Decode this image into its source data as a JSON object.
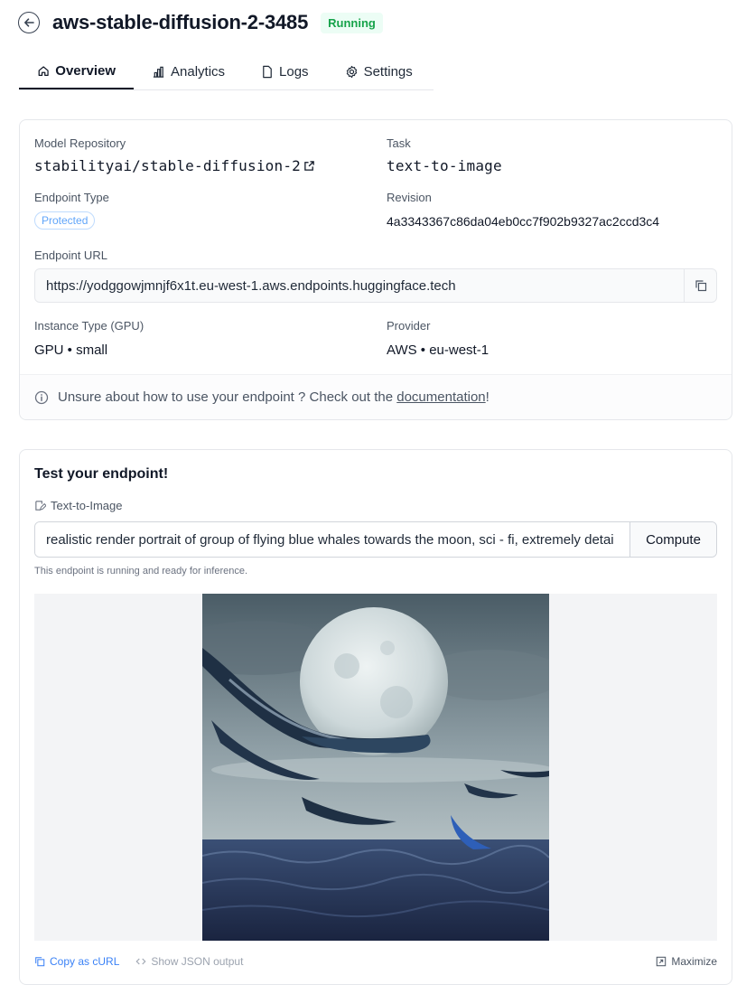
{
  "header": {
    "title": "aws-stable-diffusion-2-3485",
    "status": "Running"
  },
  "tabs": [
    {
      "label": "Overview",
      "icon": "home-icon",
      "active": true
    },
    {
      "label": "Analytics",
      "icon": "bar-chart-icon",
      "active": false
    },
    {
      "label": "Logs",
      "icon": "file-icon",
      "active": false
    },
    {
      "label": "Settings",
      "icon": "gear-icon",
      "active": false
    }
  ],
  "overview": {
    "model_repository_label": "Model Repository",
    "model_repository": "stabilityai/stable-diffusion-2",
    "task_label": "Task",
    "task": "text-to-image",
    "endpoint_type_label": "Endpoint Type",
    "endpoint_type": "Protected",
    "revision_label": "Revision",
    "revision": "4a3343367c86da04eb0cc7f902b9327ac2ccd3c4",
    "endpoint_url_label": "Endpoint URL",
    "endpoint_url": "https://yodggowjmnjf6x1t.eu-west-1.aws.endpoints.huggingface.tech",
    "instance_type_label": "Instance Type (GPU)",
    "instance_type": "GPU • small",
    "provider_label": "Provider",
    "provider": "AWS • eu-west-1",
    "help_prefix": "Unsure about how to use your endpoint ? Check out the ",
    "help_link": "documentation",
    "help_suffix": "!"
  },
  "test": {
    "title": "Test your endpoint!",
    "task_label": "Text-to-Image",
    "prompt_value": "realistic render portrait of group of flying blue whales towards the moon, sci - fi, extremely detai",
    "compute_label": "Compute",
    "status_note": "This endpoint is running and ready for inference.",
    "copy_curl_label": "Copy as cURL",
    "show_json_label": "Show JSON output",
    "maximize_label": "Maximize"
  },
  "colors": {
    "running_badge_bg": "#ecfdf5",
    "running_badge_text": "#16a34a",
    "link_blue": "#3b82f6",
    "protected_text": "#60a5fa"
  }
}
